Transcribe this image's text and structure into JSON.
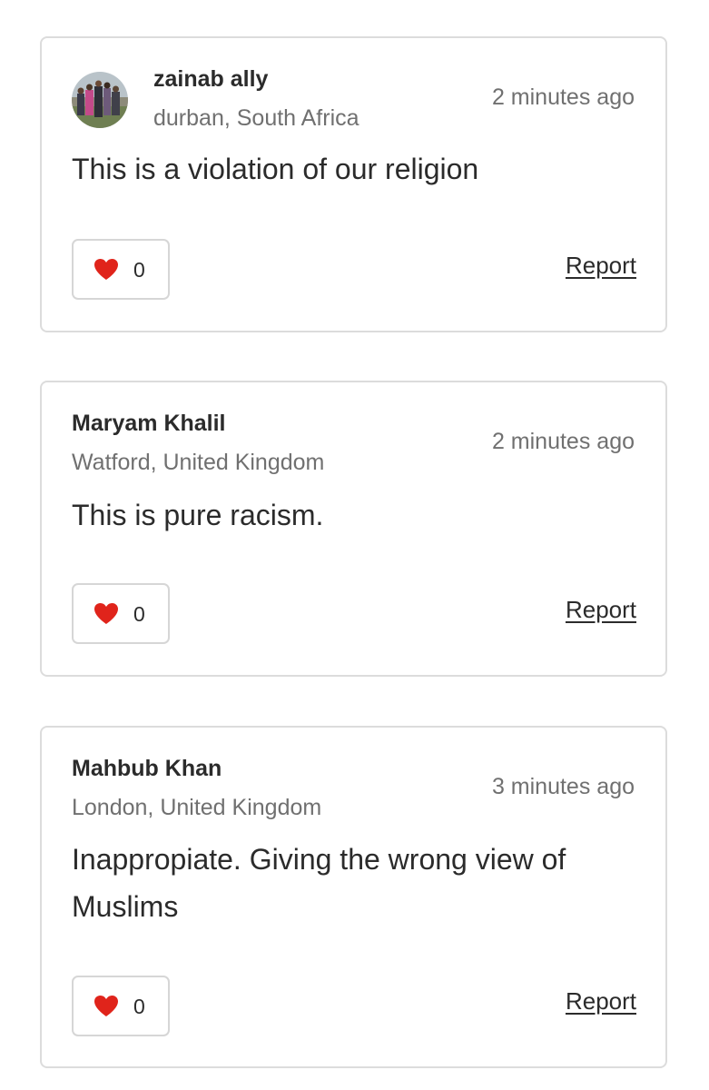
{
  "comments": [
    {
      "name": "zainab ally",
      "location": "durban, South Africa",
      "time": "2 minutes ago",
      "text": "This is a violation of our religion",
      "likes": "0",
      "report_label": "Report",
      "has_avatar": true
    },
    {
      "name": "Maryam Khalil",
      "location": "Watford, United Kingdom",
      "time": "2 minutes ago",
      "text": "This is pure racism.",
      "likes": "0",
      "report_label": "Report",
      "has_avatar": false
    },
    {
      "name": "Mahbub Khan",
      "location": "London, United Kingdom",
      "time": "3 minutes ago",
      "text": "Inappropiate. Giving the wrong view of Muslims",
      "likes": "0",
      "report_label": "Report",
      "has_avatar": false
    }
  ],
  "icons": {
    "like": "heart-icon"
  },
  "colors": {
    "heart": "#e0241b",
    "border": "#dcdcdc",
    "muted_text": "#707070"
  }
}
